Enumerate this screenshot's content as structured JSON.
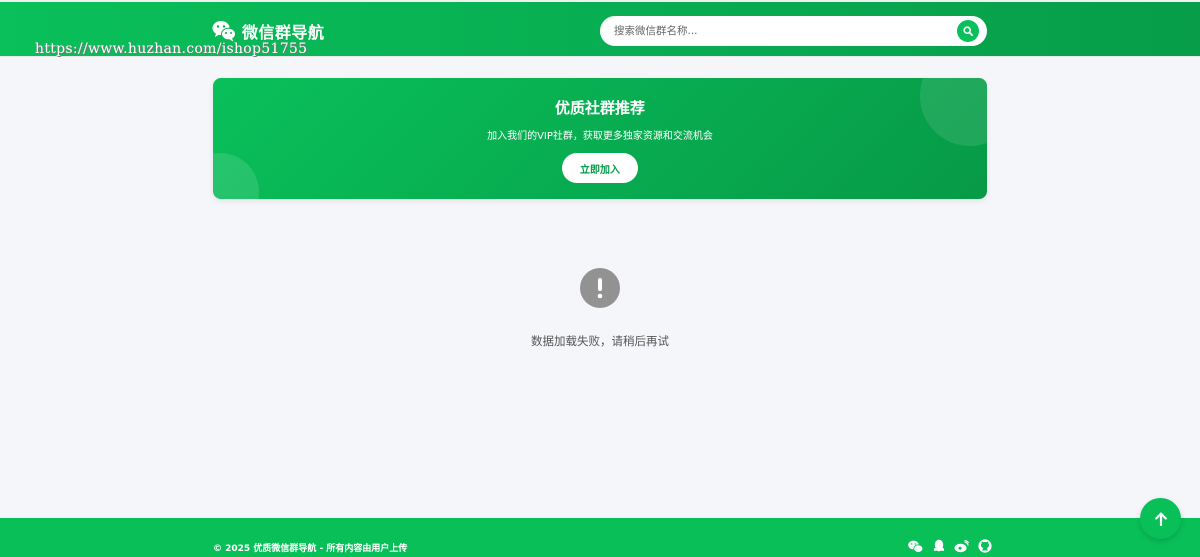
{
  "header": {
    "logo_icon": "wechat-icon",
    "site_title": "微信群导航",
    "watermark": "https://www.huzhan.com/ishop51755",
    "search": {
      "placeholder": "搜索微信群名称...",
      "value": "",
      "button_icon": "search-icon"
    }
  },
  "banner": {
    "title": "优质社群推荐",
    "subtitle": "加入我们的VIP社群，获取更多独家资源和交流机会",
    "button_label": "立即加入"
  },
  "status": {
    "icon": "exclamation-circle-icon",
    "message": "数据加载失败，请稍后再试"
  },
  "footer": {
    "copyright": "© 2025 优质微信群导航 - 所有内容由用户上传",
    "social_icons": [
      "wechat-icon",
      "qq-icon",
      "weibo-icon",
      "github-icon"
    ]
  },
  "back_to_top_icon": "arrow-up-icon",
  "colors": {
    "brand_green": "#09c05a",
    "brand_green_dark": "#079d49",
    "page_background": "#f5f6fa",
    "error_icon_gray": "#929292"
  }
}
